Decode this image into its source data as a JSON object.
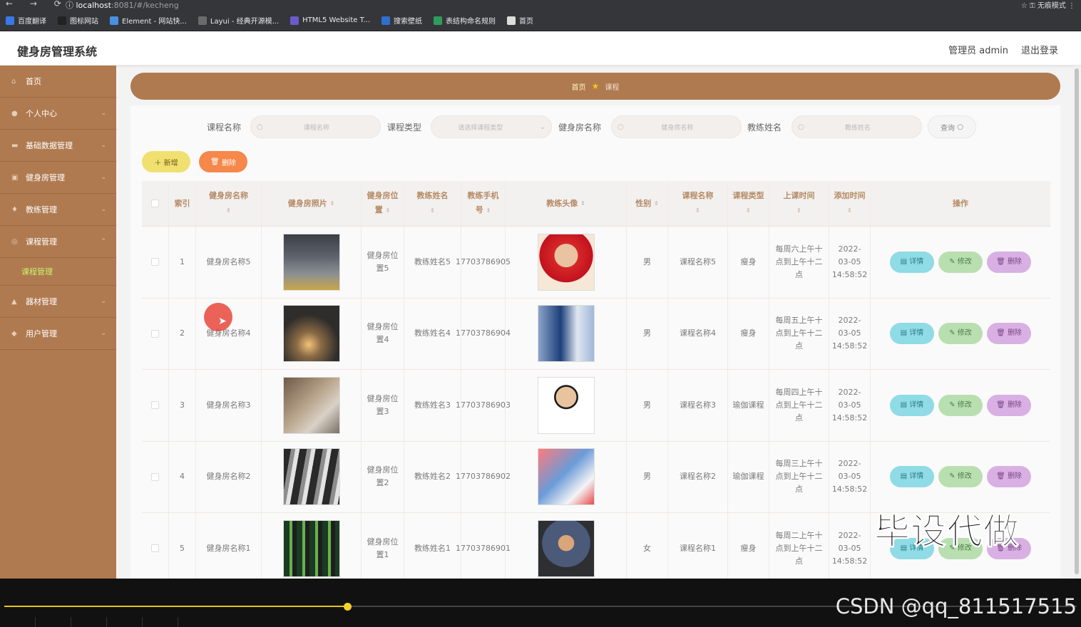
{
  "browser": {
    "url_host": "localhost",
    "url_path": ":8081/#/kecheng",
    "profile": "无痕模式",
    "bookmarks": [
      {
        "label": "百度翻译",
        "color": "#3a78e7"
      },
      {
        "label": "图标网站",
        "color": "#222222"
      },
      {
        "label": "Element - 网站快...",
        "color": "#4a90e2"
      },
      {
        "label": "Layui - 经典开源模...",
        "color": "#6b6b6b"
      },
      {
        "label": "HTML5 Website T...",
        "color": "#6a5acd"
      },
      {
        "label": "搜索壁纸",
        "color": "#2f6fd0"
      },
      {
        "label": "表结构命名规则",
        "color": "#2e9d5b"
      },
      {
        "label": "首页",
        "color": "#dddddd"
      }
    ]
  },
  "header": {
    "title": "健身房管理系统",
    "user": "管理员 admin",
    "logout": "退出登录"
  },
  "sidebar": {
    "items": [
      {
        "label": "首页",
        "icon": "home-icon"
      },
      {
        "label": "个人中心",
        "icon": "user-icon"
      },
      {
        "label": "基础数据管理",
        "icon": "data-icon"
      },
      {
        "label": "健身房管理",
        "icon": "gym-icon"
      },
      {
        "label": "教练管理",
        "icon": "coach-icon"
      },
      {
        "label": "课程管理",
        "icon": "course-icon"
      },
      {
        "label": "器材管理",
        "icon": "equipment-icon"
      },
      {
        "label": "用户管理",
        "icon": "users-icon"
      }
    ],
    "active_sub": "课程管理"
  },
  "breadcrumb": {
    "home": "首页",
    "current": "课程"
  },
  "search": {
    "course_name_label": "课程名称",
    "course_name_placeholder": "课程名称",
    "course_type_label": "课程类型",
    "course_type_placeholder": "请选择课程类型",
    "gym_name_label": "健身房名称",
    "gym_name_placeholder": "健身房名称",
    "coach_name_label": "教练姓名",
    "coach_name_placeholder": "教练姓名",
    "query_label": "查询"
  },
  "actions": {
    "add": "新增",
    "delete": "删除"
  },
  "table": {
    "headers": {
      "index": "索引",
      "gym_name": "健身房名称",
      "gym_photo": "健身房照片",
      "gym_position": "健身房位置",
      "coach_name": "教练姓名",
      "coach_phone": "教练手机号",
      "coach_avatar": "教练头像",
      "sex": "性别",
      "course_name": "课程名称",
      "course_type": "课程类型",
      "class_time": "上课时间",
      "added_time": "添加时间",
      "ops": "操作"
    },
    "op_labels": {
      "detail": "详情",
      "edit": "修改",
      "delete": "删除"
    },
    "rows": [
      {
        "index": "1",
        "gym_name": "健身房名称5",
        "gym_position": "健身房位置5",
        "coach_name": "教练姓名5",
        "coach_phone": "17703786905",
        "sex": "男",
        "course_name": "课程名称5",
        "course_type": "瘦身",
        "class_time": "每周六上午十点到上午十二点",
        "added_time": "2022-03-05 14:58:52"
      },
      {
        "index": "2",
        "gym_name": "健身房名称4",
        "gym_position": "健身房位置4",
        "coach_name": "教练姓名4",
        "coach_phone": "17703786904",
        "sex": "男",
        "course_name": "课程名称4",
        "course_type": "瘦身",
        "class_time": "每周五上午十点到上午十二点",
        "added_time": "2022-03-05 14:58:52"
      },
      {
        "index": "3",
        "gym_name": "健身房名称3",
        "gym_position": "健身房位置3",
        "coach_name": "教练姓名3",
        "coach_phone": "17703786903",
        "sex": "男",
        "course_name": "课程名称3",
        "course_type": "瑜伽课程",
        "class_time": "每周四上午十点到上午十二点",
        "added_time": "2022-03-05 14:58:52"
      },
      {
        "index": "4",
        "gym_name": "健身房名称2",
        "gym_position": "健身房位置2",
        "coach_name": "教练姓名2",
        "coach_phone": "17703786902",
        "sex": "男",
        "course_name": "课程名称2",
        "course_type": "瑜伽课程",
        "class_time": "每周三上午十点到上午十二点",
        "added_time": "2022-03-05 14:58:52"
      },
      {
        "index": "5",
        "gym_name": "健身房名称1",
        "gym_position": "健身房位置1",
        "coach_name": "教练姓名1",
        "coach_phone": "17703786901",
        "sex": "女",
        "course_name": "课程名称1",
        "course_type": "瘦身",
        "class_time": "每周二上午十点到上午十二点",
        "added_time": "2022-03-05 14:58:52"
      }
    ]
  },
  "watermark": "毕设代做",
  "player": {
    "progress_fraction": 0.32,
    "credit": "CSDN @qq_811517515"
  },
  "colors": {
    "sidebar": "#b07a50",
    "accent_sub": "#c8f06c",
    "progress": "#e8c21a"
  }
}
